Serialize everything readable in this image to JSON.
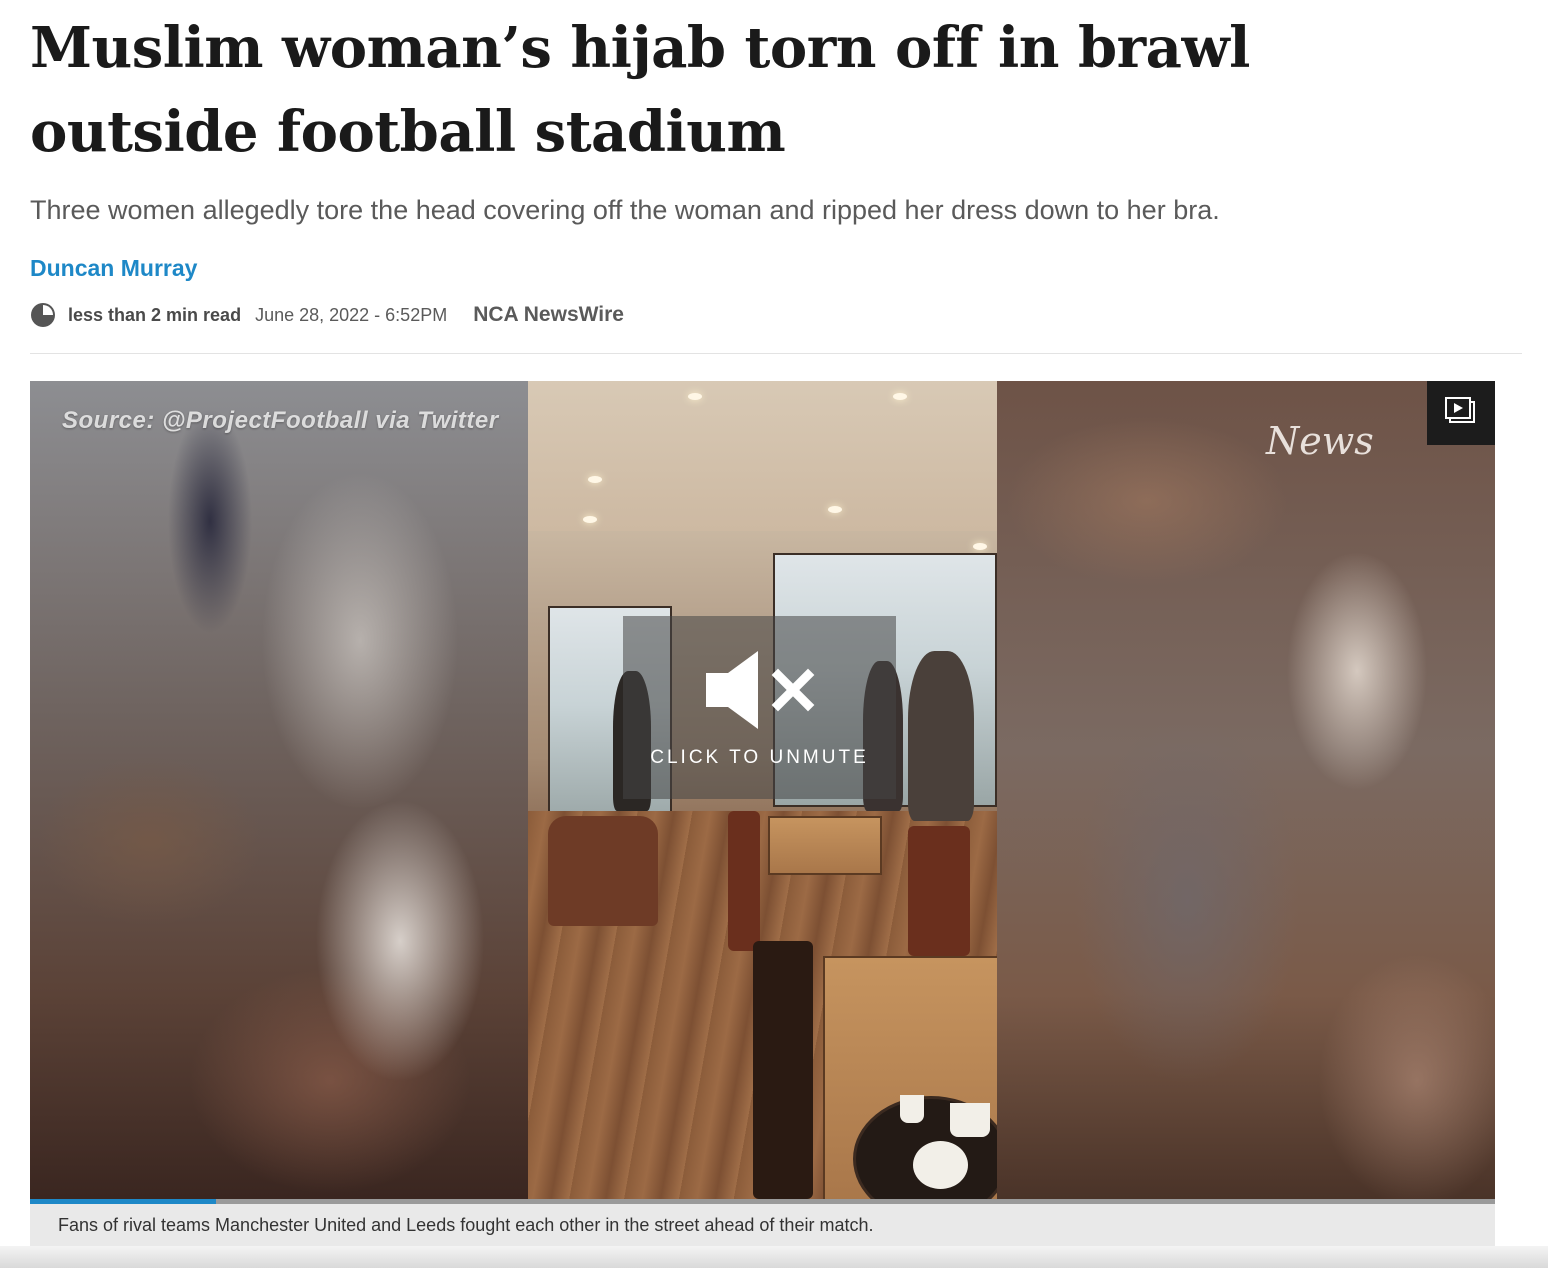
{
  "article": {
    "headline": "Muslim woman’s hijab torn off in brawl outside football stadium",
    "standfirst": "Three women allegedly tore the head covering off the woman and ripped her dress down to her bra.",
    "author": "Duncan Murray",
    "read_time": "less than 2 min read",
    "date": "June 28, 2022 - 6:52PM",
    "source": "NCA NewsWire"
  },
  "video": {
    "watermark": "Source: @ProjectFootball via Twitter",
    "brand_logo": "News",
    "unmute_label": "CLICK TO UNMUTE",
    "muted": true,
    "progress": 0.127,
    "caption": "Fans of rival teams Manchester United and Leeds fought each other in the street ahead of their match."
  },
  "icons": {
    "clock": "clock-icon",
    "speaker_muted": "speaker-muted-icon",
    "playlist": "video-playlist-icon"
  },
  "colors": {
    "headline": "#1a1a1a",
    "byline": "#1e88c7",
    "progress_fill": "#1e88c7",
    "meta_text": "#5a5a5a"
  }
}
